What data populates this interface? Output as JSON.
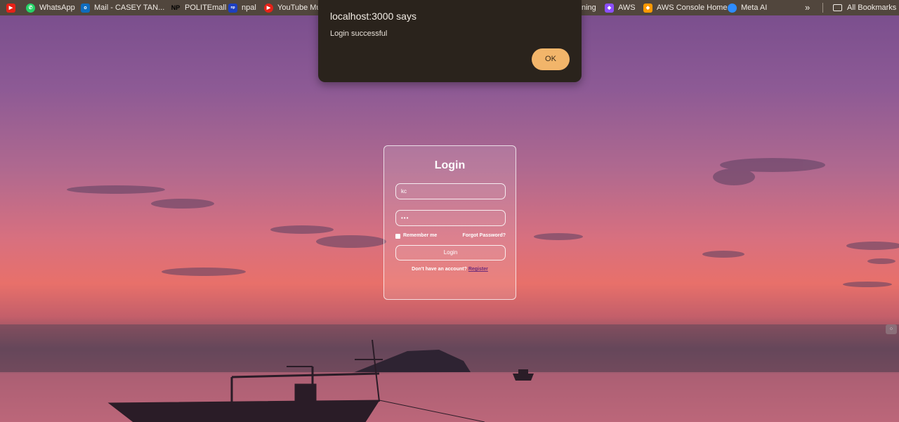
{
  "bookmarks": {
    "items": [
      {
        "label": "",
        "icon": "youtube-icon",
        "color": "#e62117"
      },
      {
        "label": "WhatsApp",
        "icon": "whatsapp-icon",
        "color": "#25d366"
      },
      {
        "label": "Mail - CASEY TAN...",
        "icon": "outlook-icon",
        "color": "#0f6cbd"
      },
      {
        "label": "POLITEmall",
        "icon": "np-icon",
        "color": "#111111"
      },
      {
        "label": "npal",
        "icon": "npal-icon",
        "color": "#1d3fbf"
      },
      {
        "label": "YouTube Mus",
        "icon": "youtube-music-icon",
        "color": "#e62117"
      },
      {
        "label": "ning",
        "icon": "",
        "color": ""
      },
      {
        "label": "AWS",
        "icon": "aws-cube-icon",
        "color": "#8c4fff"
      },
      {
        "label": "AWS Console Home",
        "icon": "aws-console-icon",
        "color": "#ff9900"
      },
      {
        "label": "Meta AI",
        "icon": "meta-ai-icon",
        "color": "#2d8cff"
      }
    ],
    "overflow": "»",
    "all_bookmarks": "All Bookmarks"
  },
  "dialog": {
    "title": "localhost:3000 says",
    "message": "Login successful",
    "ok_label": "OK",
    "accent": "#f2b56a"
  },
  "login": {
    "title": "Login",
    "username_value": "kc",
    "password_value": "•••",
    "remember_label": "Remember me",
    "forgot_label": "Forgot Password?",
    "button_label": "Login",
    "register_prompt": "Don't have an account?",
    "register_link": "Register"
  }
}
